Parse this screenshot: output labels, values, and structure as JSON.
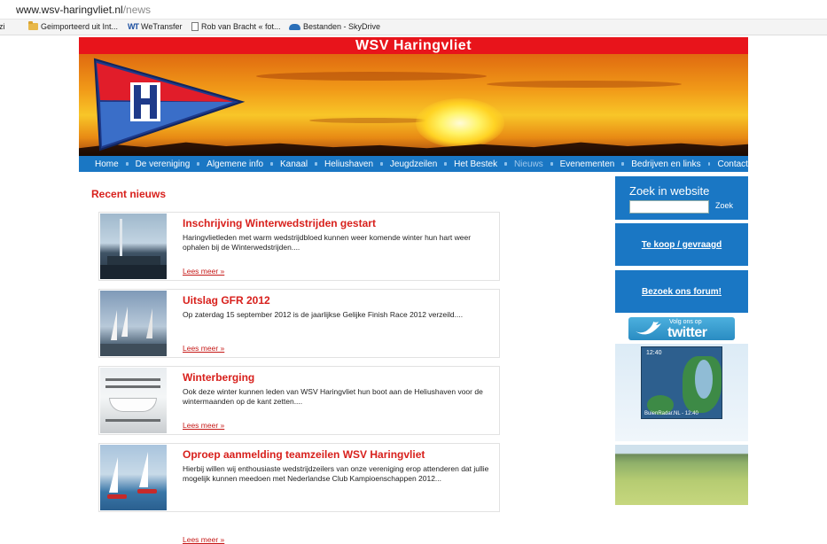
{
  "browser": {
    "url_domain": "www.wsv-haringvliet.nl",
    "url_path": "/news",
    "bookmarks": [
      "zi",
      "Geimporteerd uit Int...",
      "WeTransfer",
      "Rob van Bracht « fot...",
      "Bestanden - SkyDrive"
    ]
  },
  "site": {
    "title": "WSV Haringvliet",
    "nav": [
      "Home",
      "De vereniging",
      "Algemene info",
      "Kanaal",
      "Heliushaven",
      "Jeugdzeilen",
      "Het Bestek",
      "Nieuws",
      "Evenementen",
      "Bedrijven en links",
      "Contact"
    ],
    "nav_active": "Nieuws",
    "recent_title": "Recent nieuws",
    "read_more": "Lees meer »",
    "news": [
      {
        "title": "Inschrijving Winterwedstrijden gestart",
        "summary": "Haringvlietleden met warm wedstrijdbloed kunnen weer komende winter hun hart weer ophalen bij de Winterwedstrijden...."
      },
      {
        "title": "Uitslag GFR 2012",
        "summary": "Op zaterdag 15 september 2012 is de jaarlijkse Gelijke Finish Race 2012 verzeild...."
      },
      {
        "title": "Winterberging",
        "summary": "Ook deze winter kunnen leden van WSV Haringvliet hun boot aan de Heliushaven voor de wintermaanden op de kant zetten...."
      },
      {
        "title": "Oproep aanmelding teamzeilen WSV Haringvliet",
        "summary": "Hierbij willen wij enthousiaste wedstrijdzeilers van onze vereniging erop attenderen dat jullie mogelijk kunnen meedoen met Nederlandse Club Kampioenschappen 2012..."
      }
    ],
    "sidebar": {
      "search_title": "Zoek in website",
      "search_value": "",
      "search_button": "Zoek",
      "link1": "Te koop / gevraagd",
      "link2": "Bezoek ons forum!",
      "twitter_small": "Volg ons op",
      "twitter_big": "twitter",
      "radar_time_top": "12:40",
      "radar_credit": "BuienRadar.NL - 12:40"
    },
    "colors": {
      "brand_red": "#e8141b",
      "nav_blue": "#1a77c4",
      "news_red": "#d8201c"
    }
  }
}
